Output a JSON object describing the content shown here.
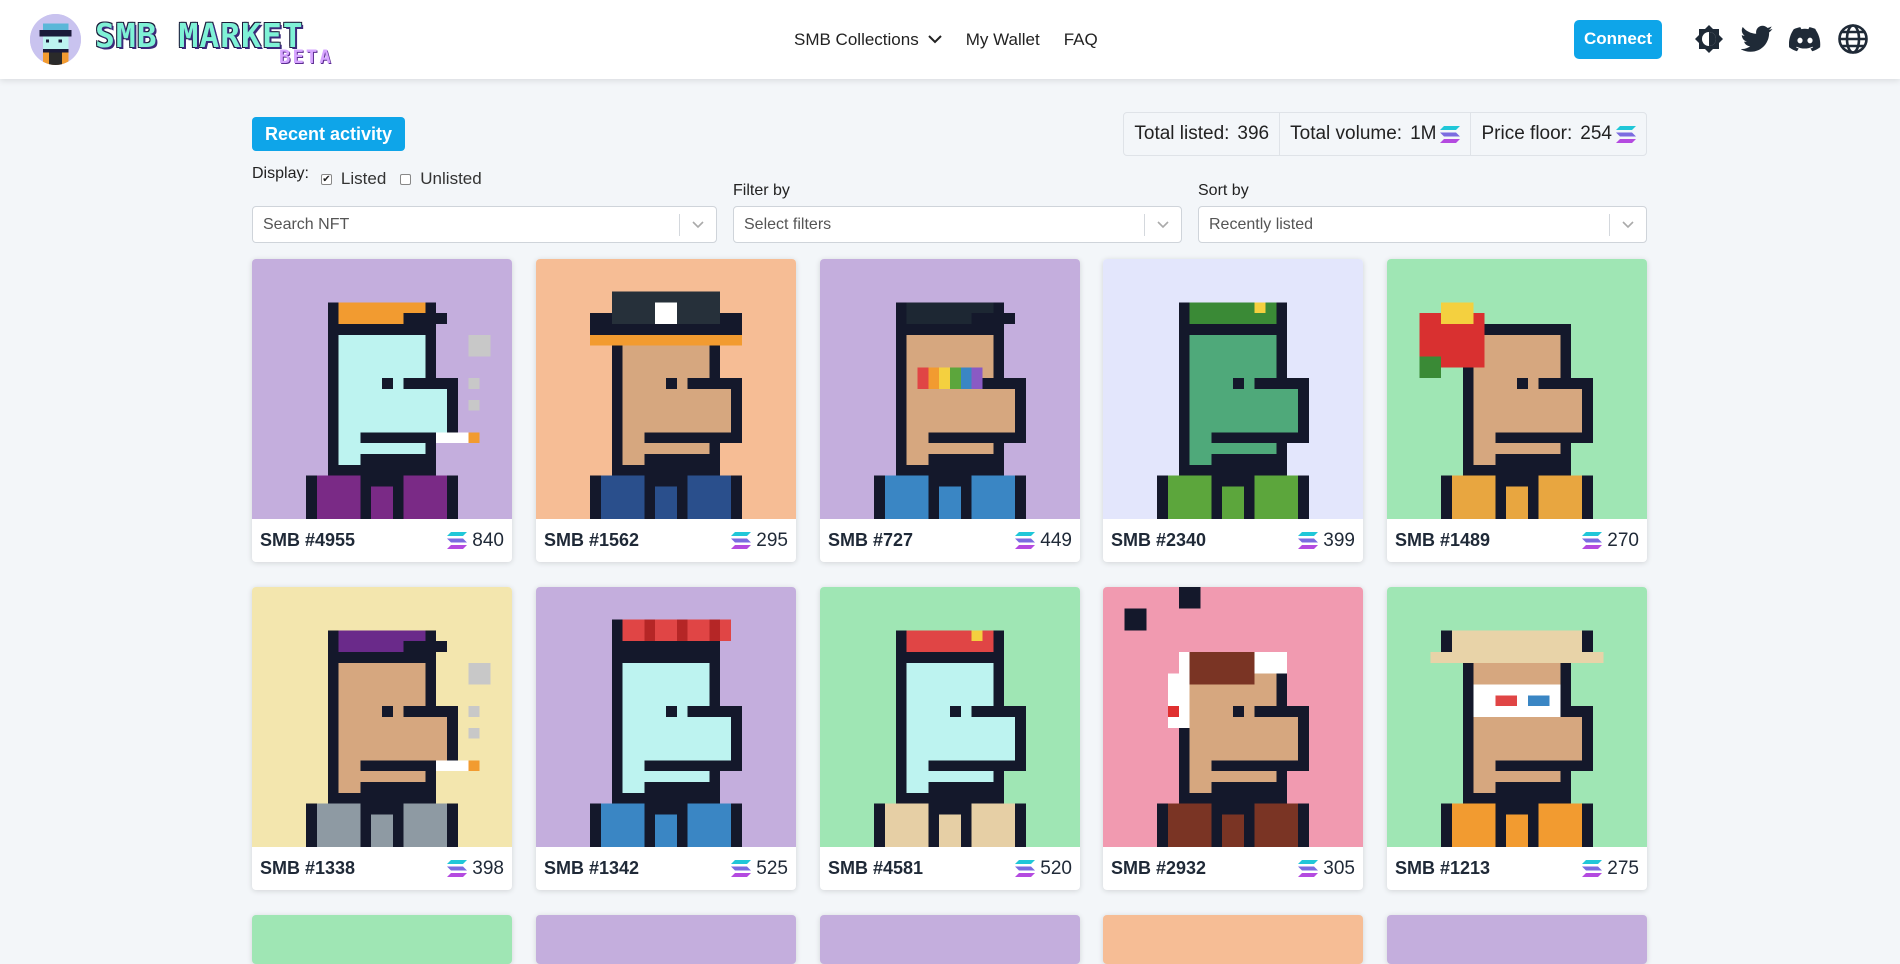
{
  "brand": {
    "title": "SMB MARKET",
    "subtitle": "BETA"
  },
  "nav": {
    "collections": "SMB Collections",
    "wallet": "My Wallet",
    "faq": "FAQ"
  },
  "header": {
    "connect_label": "Connect",
    "icons": [
      "theme-toggle-icon",
      "twitter-icon",
      "discord-icon",
      "globe-icon"
    ]
  },
  "toolbar": {
    "recent_activity": "Recent activity",
    "stats": {
      "listed_label": "Total listed:",
      "listed_value": "396",
      "volume_label": "Total volume:",
      "volume_value": "1M",
      "floor_label": "Price floor:",
      "floor_value": "254"
    },
    "display": {
      "label": "Display:",
      "listed": "Listed",
      "listed_checked": true,
      "unlisted": "Unlisted",
      "unlisted_checked": false
    },
    "search_placeholder": "Search NFT",
    "filter_label": "Filter by",
    "filter_placeholder": "Select filters",
    "sort_label": "Sort by",
    "sort_value": "Recently listed"
  },
  "colors": {
    "accent": "#0ea5e9"
  },
  "cards": [
    {
      "name": "SMB #4955",
      "price": "840",
      "bg": "#c4aedd",
      "face": "#bdf3f0",
      "hat": "#f29b30",
      "clothes": "#7a2a86",
      "trait": "smoke"
    },
    {
      "name": "SMB #1562",
      "price": "295",
      "bg": "#f6bd95",
      "face": "#d6a77f",
      "hat": "#26303a",
      "clothes": "#2a4f8c",
      "trait": "pirate"
    },
    {
      "name": "SMB #727",
      "price": "449",
      "bg": "#c4aedd",
      "face": "#d6a77f",
      "hat": "#1d2733",
      "clothes": "#3a86c4",
      "trait": "rainbow"
    },
    {
      "name": "SMB #2340",
      "price": "399",
      "bg": "#e3e6fc",
      "face": "#4fa97a",
      "hat": "#3a8a36",
      "clothes": "#5ca63c",
      "trait": "beret"
    },
    {
      "name": "SMB #1489",
      "price": "270",
      "bg": "#9fe6b4",
      "face": "#d6a77f",
      "hat": "#d93030",
      "clothes": "#e8a640",
      "trait": "flower"
    },
    {
      "name": "SMB #1338",
      "price": "398",
      "bg": "#f3e6ae",
      "face": "#d6a77f",
      "hat": "#6a2a8a",
      "clothes": "#8e9aa3",
      "trait": "smoke"
    },
    {
      "name": "SMB #1342",
      "price": "525",
      "bg": "#c4aedd",
      "face": "#bdf3f0",
      "hat": "#e04545",
      "clothes": "#3a86c4",
      "trait": "crown"
    },
    {
      "name": "SMB #4581",
      "price": "520",
      "bg": "#9fe6b4",
      "face": "#bdf3f0",
      "hat": "#e04545",
      "clothes": "#e6cfa5",
      "trait": "beret"
    },
    {
      "name": "SMB #2932",
      "price": "305",
      "bg": "#f19ab0",
      "face": "#d6a77f",
      "hat": "#ffffff",
      "clothes": "#7a3424",
      "trait": "music"
    },
    {
      "name": "SMB #1213",
      "price": "275",
      "bg": "#9fe6b4",
      "face": "#d6a77f",
      "hat": "#e8d3a8",
      "clothes": "#f29b30",
      "trait": "glasses3d"
    }
  ],
  "peek_cards": [
    {
      "bg": "#9fe6b4"
    },
    {
      "bg": "#c4aedd"
    },
    {
      "bg": "#c4aedd"
    },
    {
      "bg": "#f6bd95"
    },
    {
      "bg": "#c4aedd"
    }
  ]
}
